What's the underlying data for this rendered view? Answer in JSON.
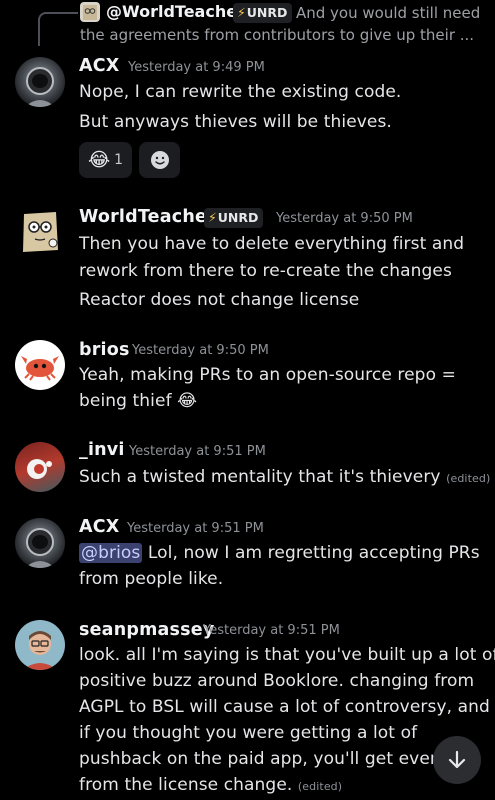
{
  "reply": {
    "author": "@WorldTeacher",
    "tag": "UNRD",
    "preview_line1": "And you would still need",
    "preview_line2": "the agreements from contributors to give up their ..."
  },
  "messages": [
    {
      "author": "ACX",
      "timestamp": "Yesterday at 9:49 PM",
      "lines": [
        "Nope, I can rewrite the existing code.",
        "But anyways thieves will be thieves."
      ],
      "reaction": {
        "emoji": "😂",
        "count": "1"
      }
    },
    {
      "author": "WorldTeacher",
      "tag": "UNRD",
      "timestamp": "Yesterday at 9:50 PM",
      "lines": [
        "Then you have to delete everything first and",
        "rework from there to re-create the changes",
        "Reactor does not change license"
      ]
    },
    {
      "author": "brios",
      "timestamp": "Yesterday at 9:50 PM",
      "lines": [
        "Yeah, making PRs to an open-source repo =",
        "being thief 😂"
      ]
    },
    {
      "author": "_invi",
      "timestamp": "Yesterday at 9:51 PM",
      "lines": [
        "Such a twisted mentality that it's thievery"
      ],
      "edited": "(edited)"
    },
    {
      "author": "ACX",
      "timestamp": "Yesterday at 9:51 PM",
      "mention": "@brios",
      "lines": [
        "Lol, now I am regretting accepting PRs",
        "from people like."
      ]
    },
    {
      "author": "seanpmassey",
      "timestamp": "Yesterday at 9:51 PM",
      "lines": [
        "look.  all I'm saying is that you've built up a lot of",
        "positive buzz around Booklore.  changing from",
        "AGPL to BSL will cause a lot of controversy, and",
        "if you thought you were getting a lot of",
        "pushback on the paid app, you'll get even r",
        "from the license change."
      ],
      "edited": "(edited)"
    }
  ],
  "icons": {
    "add_reaction": "smiley-face-icon",
    "jump_to_present": "arrow-down-icon"
  }
}
